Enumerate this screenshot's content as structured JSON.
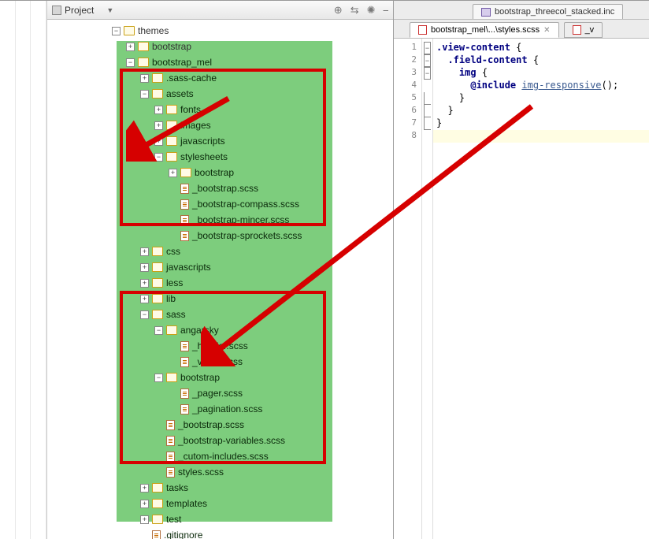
{
  "panel": {
    "title": "Project"
  },
  "toolbar_icons": [
    "target",
    "reload",
    "settings",
    "minimize"
  ],
  "tree": [
    {
      "depth": 1,
      "type": "folder",
      "exp": "minus",
      "label": "themes",
      "plain": true
    },
    {
      "depth": 2,
      "type": "folder",
      "exp": "plus",
      "label": "bootstrap",
      "plain": true
    },
    {
      "depth": 2,
      "type": "folder",
      "exp": "minus",
      "label": "bootstrap_mel"
    },
    {
      "depth": 3,
      "type": "folder",
      "exp": "plus",
      "label": ".sass-cache"
    },
    {
      "depth": 3,
      "type": "folder",
      "exp": "minus",
      "label": "assets"
    },
    {
      "depth": 4,
      "type": "folder",
      "exp": "plus",
      "label": "fonts"
    },
    {
      "depth": 4,
      "type": "folder",
      "exp": "plus",
      "label": "images"
    },
    {
      "depth": 4,
      "type": "folder",
      "exp": "plus",
      "label": "javascripts"
    },
    {
      "depth": 4,
      "type": "folder",
      "exp": "minus",
      "label": "stylesheets"
    },
    {
      "depth": 5,
      "type": "folder",
      "exp": "plus",
      "label": "bootstrap"
    },
    {
      "depth": 5,
      "type": "file",
      "label": "_bootstrap.scss"
    },
    {
      "depth": 5,
      "type": "file",
      "label": "_bootstrap-compass.scss"
    },
    {
      "depth": 5,
      "type": "file",
      "label": "_bootstrap-mincer.scss"
    },
    {
      "depth": 5,
      "type": "file",
      "label": "_bootstrap-sprockets.scss"
    },
    {
      "depth": 3,
      "type": "folder",
      "exp": "plus",
      "label": "css"
    },
    {
      "depth": 3,
      "type": "folder",
      "exp": "plus",
      "label": "javascripts"
    },
    {
      "depth": 3,
      "type": "folder",
      "exp": "plus",
      "label": "less"
    },
    {
      "depth": 3,
      "type": "folder",
      "exp": "plus",
      "label": "lib"
    },
    {
      "depth": 3,
      "type": "folder",
      "exp": "minus",
      "label": "sass"
    },
    {
      "depth": 4,
      "type": "folder",
      "exp": "minus",
      "label": "angarsky"
    },
    {
      "depth": 5,
      "type": "file",
      "label": "_header.scss"
    },
    {
      "depth": 5,
      "type": "file",
      "label": "_views.scss"
    },
    {
      "depth": 4,
      "type": "folder",
      "exp": "minus",
      "label": "bootstrap"
    },
    {
      "depth": 5,
      "type": "file",
      "label": "_pager.scss"
    },
    {
      "depth": 5,
      "type": "file",
      "label": "_pagination.scss"
    },
    {
      "depth": 4,
      "type": "file",
      "label": "_bootstrap.scss"
    },
    {
      "depth": 4,
      "type": "file",
      "label": "_bootstrap-variables.scss"
    },
    {
      "depth": 4,
      "type": "file",
      "label": "_cutom-includes.scss"
    },
    {
      "depth": 4,
      "type": "file",
      "label": "styles.scss"
    },
    {
      "depth": 3,
      "type": "folder",
      "exp": "plus",
      "label": "tasks"
    },
    {
      "depth": 3,
      "type": "folder",
      "exp": "plus",
      "label": "templates"
    },
    {
      "depth": 3,
      "type": "folder",
      "exp": "plus",
      "label": "test"
    },
    {
      "depth": 3,
      "type": "file",
      "label": ".gitignore"
    }
  ],
  "tabs_top": {
    "label": "bootstrap_threecol_stacked.inc"
  },
  "tabs_sub": [
    {
      "label": "bootstrap_mel\\...\\styles.scss",
      "active": true
    },
    {
      "label": "_v",
      "active": false,
      "cut": true
    }
  ],
  "code": {
    "lines": [
      {
        "n": 1,
        "ind": 0,
        "t": [
          {
            "c": "sel",
            "v": ".view-content"
          },
          {
            "c": "pnc",
            "v": " {"
          }
        ]
      },
      {
        "n": 2,
        "ind": 1,
        "t": [
          {
            "c": "sel",
            "v": ".field-content"
          },
          {
            "c": "pnc",
            "v": " {"
          }
        ]
      },
      {
        "n": 3,
        "ind": 2,
        "t": [
          {
            "c": "sel",
            "v": "img"
          },
          {
            "c": "pnc",
            "v": " {"
          }
        ]
      },
      {
        "n": 4,
        "ind": 3,
        "t": [
          {
            "c": "kw",
            "v": "@include"
          },
          {
            "c": "pnc",
            "v": " "
          },
          {
            "c": "fn",
            "v": "img-responsive"
          },
          {
            "c": "pnc",
            "v": "();"
          }
        ]
      },
      {
        "n": 5,
        "ind": 2,
        "t": [
          {
            "c": "pnc",
            "v": "}"
          }
        ]
      },
      {
        "n": 6,
        "ind": 1,
        "t": [
          {
            "c": "pnc",
            "v": "}"
          }
        ]
      },
      {
        "n": 7,
        "ind": 0,
        "t": [
          {
            "c": "pnc",
            "v": "}"
          }
        ]
      },
      {
        "n": 8,
        "ind": 0,
        "t": [],
        "hl": true
      }
    ],
    "fold": [
      "open",
      "open",
      "open",
      "",
      "close",
      "close",
      "close",
      ""
    ]
  }
}
